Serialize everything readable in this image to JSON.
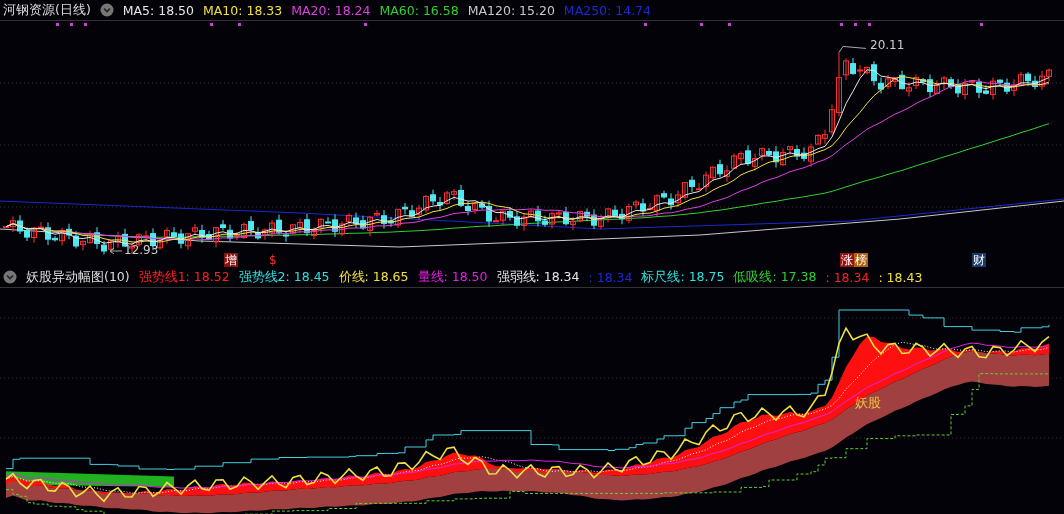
{
  "main_panel": {
    "title": "河钢资源(日线)",
    "indicators": [
      {
        "label": "MA5: 18.50",
        "color": "#e6e6e6"
      },
      {
        "label": "MA10: 18.33",
        "color": "#f0e040"
      },
      {
        "label": "MA20: 18.24",
        "color": "#e040e0"
      },
      {
        "label": "MA60: 16.58",
        "color": "#30d030"
      },
      {
        "label": "MA120: 15.20",
        "color": "#c8c8c8"
      },
      {
        "label": "MA250: 14.74",
        "color": "#1a2ad0"
      }
    ],
    "high_label": "20.11",
    "low_label": "12.93",
    "markers": [
      {
        "text": "增",
        "color": "#8a1010"
      },
      {
        "text": "$",
        "color": "#000000"
      },
      {
        "text": "涨",
        "color": "#9a1010"
      },
      {
        "text": "榜",
        "color": "#b06010"
      },
      {
        "text": "财",
        "color": "#1a3a6a"
      }
    ]
  },
  "sub_panel": {
    "title": "妖股异动幅图(10)",
    "indicators": [
      {
        "label": "强势线1: 18.52",
        "color": "#ff2020"
      },
      {
        "label": "强势线2: 18.45",
        "color": "#30e0e0"
      },
      {
        "label": "价线: 18.65",
        "color": "#f0e040"
      },
      {
        "label": "量线: 18.50",
        "color": "#e020e0"
      },
      {
        "label": "强弱线: 18.34",
        "color": "#e6e6e6"
      },
      {
        "label": ": 18.34",
        "color": "#1a2ad0"
      },
      {
        "label": "标尺线: 18.75",
        "color": "#30e0e0"
      },
      {
        "label": "低吸线: 17.38",
        "color": "#30d030"
      },
      {
        "label": ": 18.34",
        "color": "#ff2020"
      },
      {
        "label": ": 18.43",
        "color": "#f0e040"
      }
    ],
    "annotation": "妖股"
  }
}
